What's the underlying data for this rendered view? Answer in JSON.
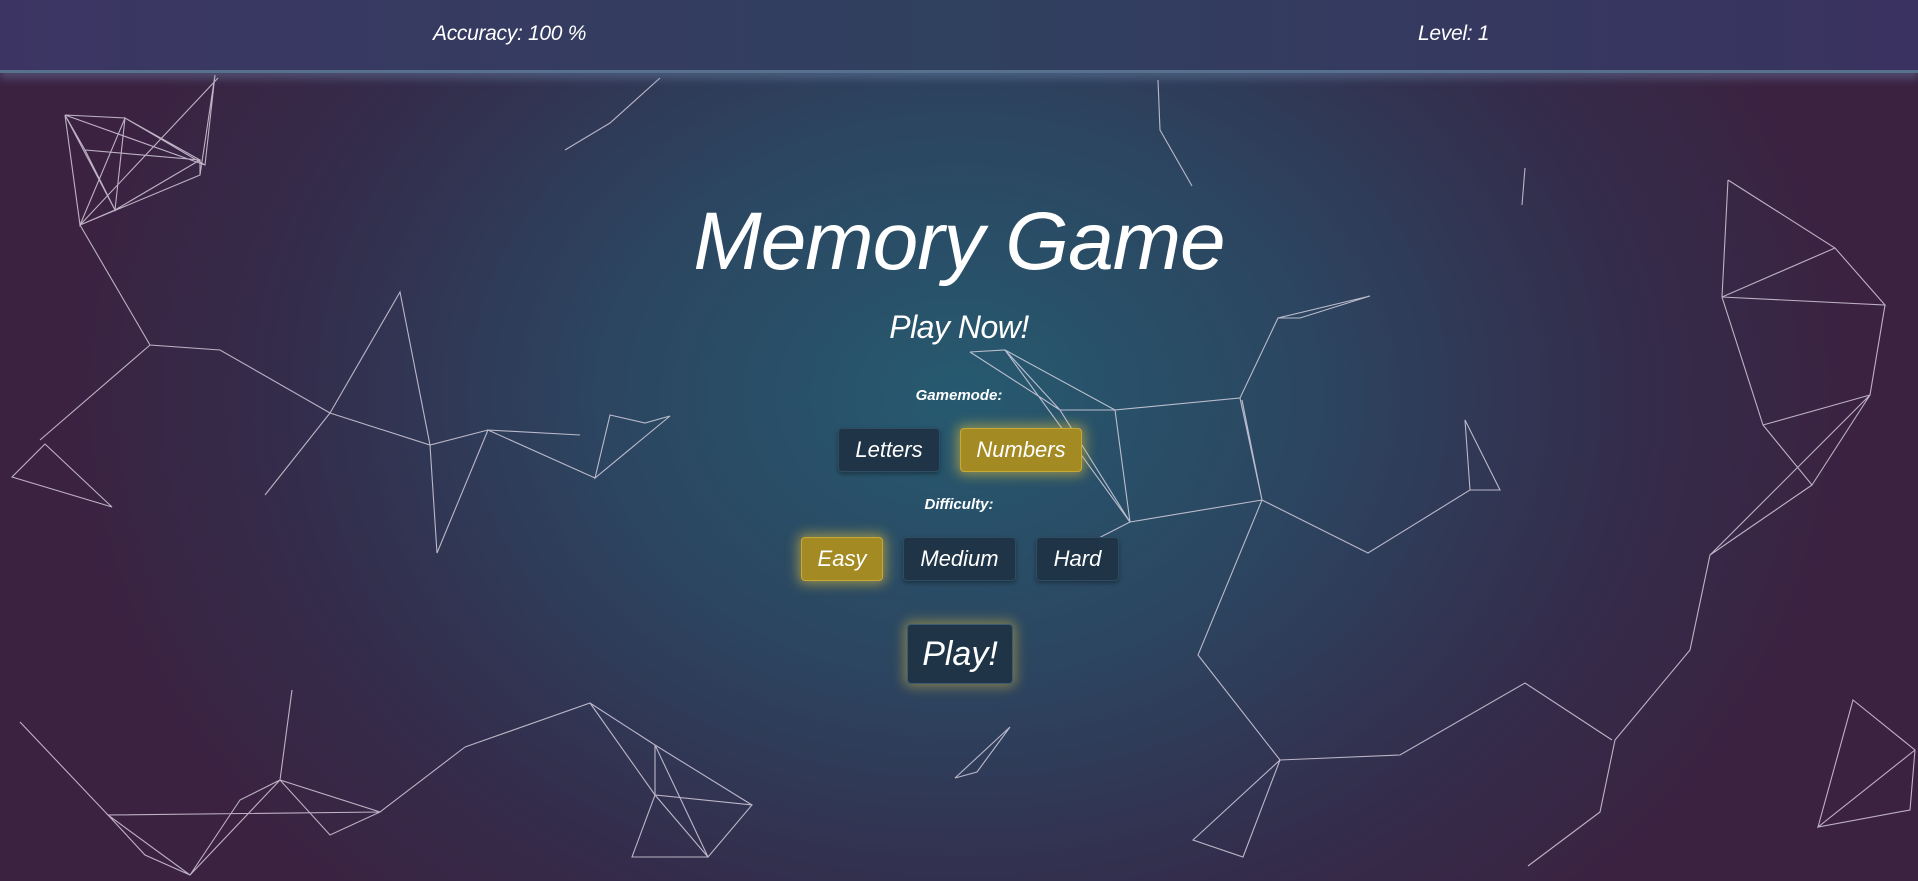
{
  "topbar": {
    "accuracy": "Accuracy: 100 %",
    "level": "Level: 1"
  },
  "main": {
    "title": "Memory Game",
    "subtitle": "Play Now!",
    "gamemode_label": "Gamemode:",
    "gamemode_options": [
      "Letters",
      "Numbers"
    ],
    "gamemode_selected": "Numbers",
    "difficulty_label": "Difficulty:",
    "difficulty_options": [
      "Easy",
      "Medium",
      "Hard"
    ],
    "difficulty_selected": "Easy",
    "play_label": "Play!"
  },
  "colors": {
    "accent_gold": "#a48a22",
    "button_dark": "#1f3446",
    "background_center": "#265a70",
    "background_edge": "#3b2241"
  }
}
